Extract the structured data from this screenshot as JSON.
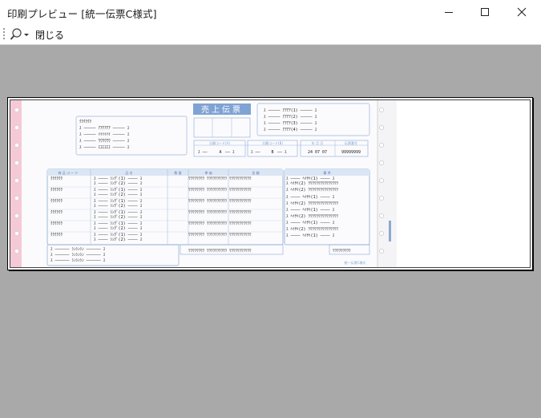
{
  "window": {
    "title": "印刷プレビュー [統一伝票C様式]"
  },
  "toolbar": {
    "zoom_icon": "magnifier-icon",
    "close_label": "閉じる"
  },
  "form": {
    "title": "売上伝票",
    "col_code": "商 品 コ ー ド",
    "col_name": "品 名",
    "col_qty": "数 量",
    "col_price": "単 価",
    "col_amount": "金 額",
    "col_remarks": "備 考",
    "dest_code_a": "分類コード(A)",
    "dest_code_b": "分類コード(B)",
    "date_label": "年 月 日",
    "slip_no_label": "伝票番号",
    "date_value": "24  07  07",
    "code_a_value": "A",
    "code_b_value": "B",
    "slip_no_value": "99999999",
    "footer_text": "統一伝票C様式"
  }
}
